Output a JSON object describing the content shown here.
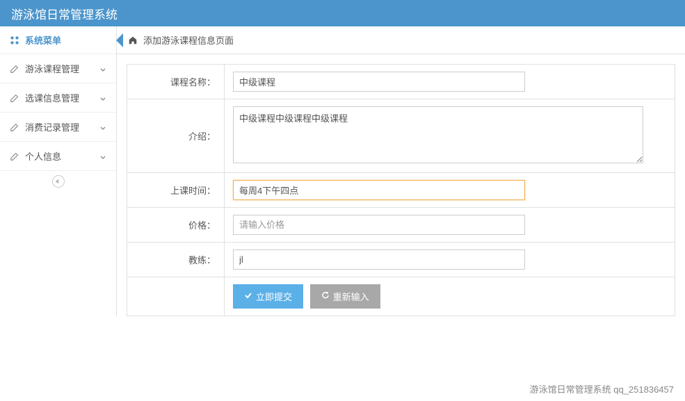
{
  "header": {
    "title": "游泳馆日常管理系统"
  },
  "sidebar": {
    "menu_title": "系统菜单",
    "items": [
      {
        "label": "游泳课程管理"
      },
      {
        "label": "选课信息管理"
      },
      {
        "label": "消费记录管理"
      },
      {
        "label": "个人信息"
      }
    ]
  },
  "breadcrumb": {
    "text": "添加游泳课程信息页面"
  },
  "form": {
    "course_name_label": "课程名称：",
    "course_name_value": "中级课程",
    "intro_label": "介绍：",
    "intro_value": "中级课程中级课程中级课程",
    "time_label": "上课时间：",
    "time_value": "每周4下午四点",
    "price_label": "价格：",
    "price_placeholder": "请输入价格",
    "price_value": "",
    "coach_label": "教练：",
    "coach_value": "jl",
    "submit_label": "立即提交",
    "reset_label": "重新输入"
  },
  "footer": {
    "text": "游泳馆日常管理系统 qq_251836457"
  }
}
